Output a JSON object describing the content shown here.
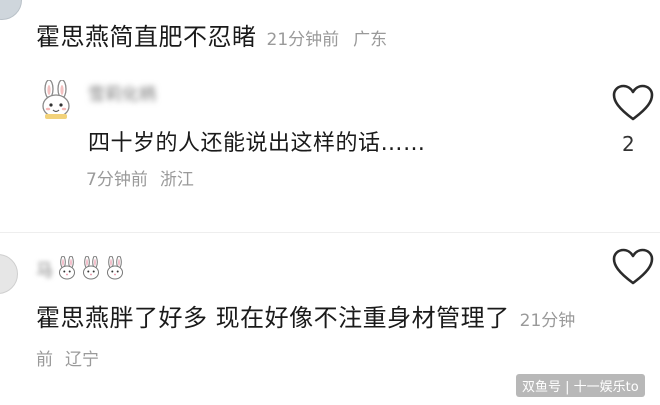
{
  "comments": [
    {
      "text": "霍思燕简直肥不忍睹",
      "time": "21分钟前",
      "location": "广东"
    },
    {
      "username": "雪莉化柄",
      "text": "四十岁的人还能说出这样的话……",
      "time": "7分钟前",
      "location": "浙江",
      "like_count": "2"
    },
    {
      "username": "马",
      "text": "霍思燕胖了好多 现在好像不注重身材管理了",
      "time": "21分钟前",
      "location": "辽宁"
    }
  ],
  "icons": {
    "like": "heart-outline-icon",
    "name_emoji": "rabbit-face-icon",
    "reply_avatar": "bunny-avatar"
  },
  "watermark": "双鱼号 | 十一娱乐to"
}
